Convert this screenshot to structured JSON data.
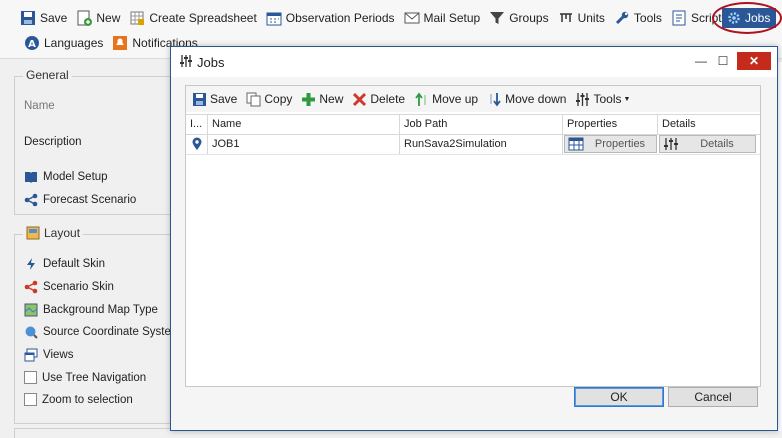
{
  "toolbar": {
    "row1": [
      {
        "label": "Save",
        "icon": "save-icon"
      },
      {
        "label": "New",
        "icon": "new-icon"
      },
      {
        "label": "Create Spreadsheet",
        "icon": "spreadsheet-icon"
      },
      {
        "label": "Observation Periods",
        "icon": "calendar-icon"
      },
      {
        "label": "Mail Setup",
        "icon": "mail-icon"
      },
      {
        "label": "Groups",
        "icon": "filter-icon"
      },
      {
        "label": "Units",
        "icon": "units-icon"
      },
      {
        "label": "Tools",
        "icon": "wrench-icon"
      },
      {
        "label": "Scripts",
        "icon": "script-icon"
      }
    ],
    "jobs": {
      "label": "Jobs",
      "icon": "jobs-gear-icon"
    },
    "row2": [
      {
        "label": "Languages",
        "icon": "languages-icon"
      },
      {
        "label": "Notifications",
        "icon": "notifications-icon"
      }
    ]
  },
  "left_panel": {
    "general": {
      "title": "General",
      "name_label": "Name",
      "description_label": "Description",
      "items": [
        {
          "label": "Model Setup",
          "icon": "book-icon"
        },
        {
          "label": "Forecast Scenario",
          "icon": "share-icon"
        }
      ]
    },
    "layout": {
      "title": "Layout",
      "items": [
        {
          "label": "Default Skin",
          "icon": "lightning-icon"
        },
        {
          "label": "Scenario Skin",
          "icon": "share-red-icon"
        },
        {
          "label": "Background Map Type",
          "icon": "map-icon"
        },
        {
          "label": "Source Coordinate System",
          "icon": "globe-icon"
        },
        {
          "label": "Views",
          "icon": "window-icon"
        }
      ],
      "checkboxes": [
        {
          "label": "Use Tree Navigation",
          "checked": false
        },
        {
          "label": "Zoom to selection",
          "checked": false
        }
      ]
    }
  },
  "dialog": {
    "title": "Jobs",
    "toolbar": [
      {
        "label": "Save",
        "icon": "save-icon"
      },
      {
        "label": "Copy",
        "icon": "copy-icon"
      },
      {
        "label": "New",
        "icon": "plus-icon"
      },
      {
        "label": "Delete",
        "icon": "delete-x-icon"
      },
      {
        "label": "Move up",
        "icon": "move-up-icon"
      },
      {
        "label": "Move down",
        "icon": "move-down-icon"
      },
      {
        "label": "Tools",
        "icon": "sliders-icon"
      }
    ],
    "columns": [
      "I...",
      "Name",
      "Job Path",
      "Properties",
      "Details"
    ],
    "rows": [
      {
        "name": "JOB1",
        "job_path": "RunSava2Simulation",
        "properties": "Properties",
        "details": "Details"
      }
    ],
    "ok_label": "OK",
    "cancel_label": "Cancel"
  },
  "colors": {
    "accent": "#2b5797",
    "highlight_ring": "#b01020",
    "close": "#c42b1c"
  }
}
